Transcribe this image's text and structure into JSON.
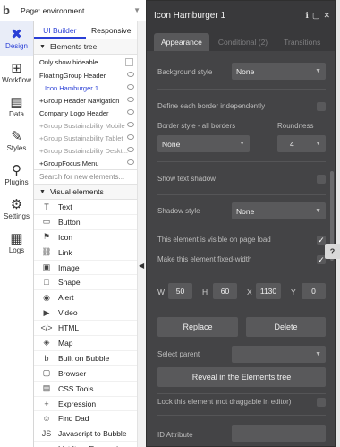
{
  "topbar": {
    "page_label": "Page: environment"
  },
  "rail": [
    {
      "label": "Design",
      "icon": "design-icon",
      "glyph": "✖",
      "active": true
    },
    {
      "label": "Workflow",
      "icon": "workflow-icon",
      "glyph": "⊞"
    },
    {
      "label": "Data",
      "icon": "data-icon",
      "glyph": "▤"
    },
    {
      "label": "Styles",
      "icon": "styles-icon",
      "glyph": "✎"
    },
    {
      "label": "Plugins",
      "icon": "plugins-icon",
      "glyph": "⚲"
    },
    {
      "label": "Settings",
      "icon": "settings-icon",
      "glyph": "⚙"
    },
    {
      "label": "Logs",
      "icon": "logs-icon",
      "glyph": "▦"
    }
  ],
  "panel": {
    "tabs": [
      "UI Builder",
      "Responsive"
    ],
    "elements_tree_label": "Elements tree",
    "show_hideable": "Only show hideable",
    "tree": [
      {
        "label": "FloatingGroup Header",
        "state": "normal"
      },
      {
        "label": "Icon Hamburger 1",
        "state": "selected"
      },
      {
        "label": "+Group Header Navigation",
        "state": "normal"
      },
      {
        "label": "Company Logo Header",
        "state": "normal"
      },
      {
        "label": "+Group Sustainability Mobile",
        "state": "dim"
      },
      {
        "label": "+Group Sustainability Tablet",
        "state": "dim"
      },
      {
        "label": "+Group Sustainability Deskt...",
        "state": "dim"
      },
      {
        "label": "+GroupFocus Menu",
        "state": "normal"
      }
    ],
    "search_placeholder": "Search for new elements...",
    "visual_elements_label": "Visual elements",
    "visual_elements": [
      {
        "label": "Text",
        "icon": "text-icon",
        "glyph": "T"
      },
      {
        "label": "Button",
        "icon": "button-icon",
        "glyph": "▭"
      },
      {
        "label": "Icon",
        "icon": "flag-icon",
        "glyph": "⚑"
      },
      {
        "label": "Link",
        "icon": "link-icon",
        "glyph": "⛓"
      },
      {
        "label": "Image",
        "icon": "image-icon",
        "glyph": "▣"
      },
      {
        "label": "Shape",
        "icon": "shape-icon",
        "glyph": "□"
      },
      {
        "label": "Alert",
        "icon": "alert-icon",
        "glyph": "◉"
      },
      {
        "label": "Video",
        "icon": "video-icon",
        "glyph": "▶"
      },
      {
        "label": "HTML",
        "icon": "html-icon",
        "glyph": "</>"
      },
      {
        "label": "Map",
        "icon": "map-icon",
        "glyph": "◈"
      },
      {
        "label": "Built on Bubble",
        "icon": "bubble-icon",
        "glyph": "b"
      },
      {
        "label": "Browser",
        "icon": "browser-icon",
        "glyph": "▢"
      },
      {
        "label": "CSS Tools",
        "icon": "css-icon",
        "glyph": "▤"
      },
      {
        "label": "Expression",
        "icon": "plus-icon",
        "glyph": "+"
      },
      {
        "label": "Find Dad",
        "icon": "face-icon",
        "glyph": "☺"
      },
      {
        "label": "Javascript to Bubble",
        "icon": "js-icon",
        "glyph": "JS"
      },
      {
        "label": "List Item Expression",
        "icon": "list-icon",
        "glyph": "≡"
      }
    ]
  },
  "editor": {
    "title": "Icon Hamburger 1",
    "tabs": [
      "Appearance",
      "Conditional (2)",
      "Transitions"
    ],
    "background_style_label": "Background style",
    "background_style_value": "None",
    "define_border_label": "Define each border independently",
    "border_style_label": "Border style - all borders",
    "border_style_value": "None",
    "roundness_label": "Roundness",
    "roundness_value": "4",
    "text_shadow_label": "Show text shadow",
    "shadow_style_label": "Shadow style",
    "shadow_style_value": "None",
    "visible_on_load_label": "This element is visible on page load",
    "fixed_width_label": "Make this element fixed-width",
    "w_label": "W",
    "w_value": "50",
    "h_label": "H",
    "h_value": "60",
    "x_label": "X",
    "x_value": "1130",
    "y_label": "Y",
    "y_value": "0",
    "replace_label": "Replace",
    "delete_label": "Delete",
    "select_parent_label": "Select parent",
    "reveal_label": "Reveal in the Elements tree",
    "lock_label": "Lock this element (not draggable in editor)",
    "id_attribute_label": "ID Attribute",
    "help_label": "?"
  }
}
